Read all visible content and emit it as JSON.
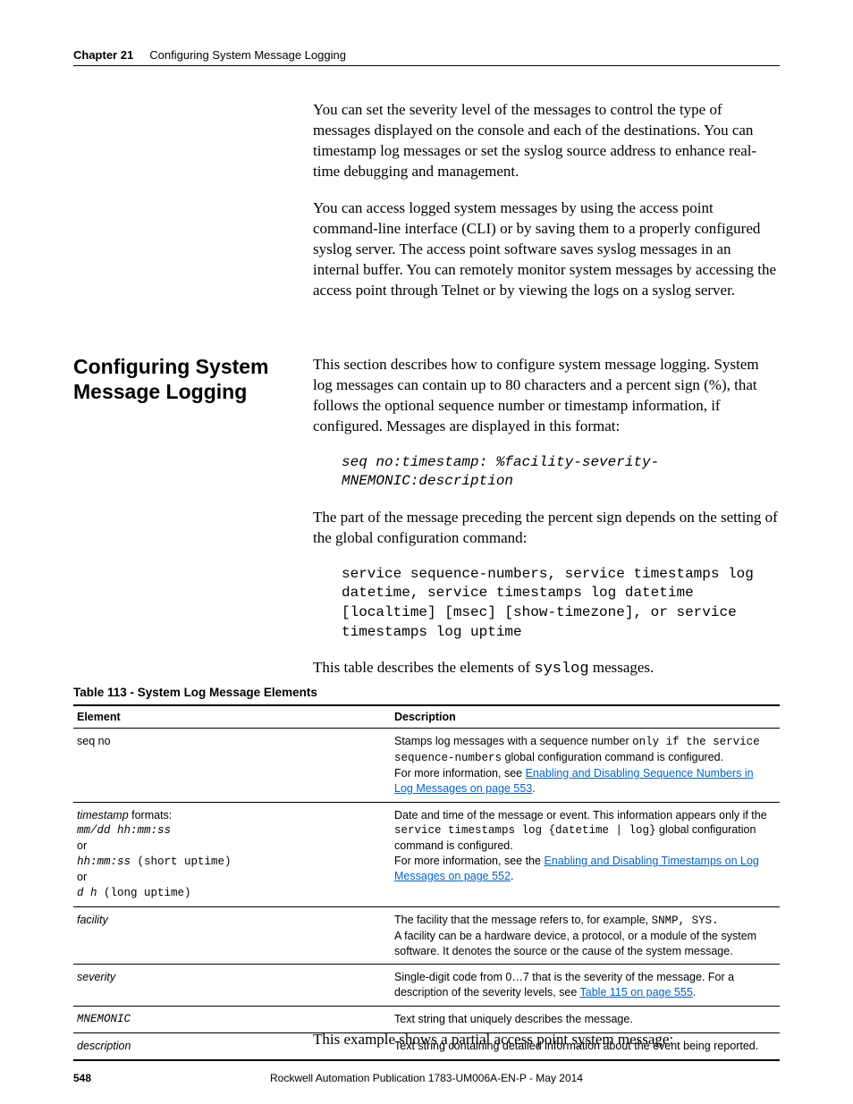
{
  "header": {
    "chapter": "Chapter 21",
    "title": "Configuring System Message Logging"
  },
  "intro": {
    "p1": "You can set the severity level of the messages to control the type of messages displayed on the console and each of the destinations. You can timestamp log messages or set the syslog source address to enhance real-time debugging and management.",
    "p2": "You can access logged system messages by using the access point command-line interface (CLI) or by saving them to a properly configured syslog server. The access point software saves syslog messages in an internal buffer. You can remotely monitor system messages by accessing the access point through Telnet or by viewing the logs on a syslog server."
  },
  "section": {
    "heading": "Configuring System Message Logging",
    "p1": "This section describes how to configure system message logging. System log messages can contain up to 80 characters and a percent sign (%), that follows the optional sequence number or timestamp information, if configured. Messages are displayed in this format:",
    "code1": "seq no:timestamp: %facility-severity-MNEMONIC:description",
    "p2": "The part of the message preceding the percent sign depends on the setting of the global configuration command:",
    "code2": "service sequence-numbers, service timestamps log datetime, service timestamps log datetime [localtime] [msec] [show-timezone], or service timestamps log uptime",
    "p3_pre": "This table describes the elements of ",
    "p3_mono": "syslog",
    "p3_post": " messages."
  },
  "table": {
    "caption": "Table 113 - System Log Message Elements",
    "head_el": "Element",
    "head_desc": "Description",
    "rows": {
      "r0": {
        "el": "seq no",
        "d_pre": "Stamps log messages with a sequence number ",
        "d_mono": "only if the service sequence-numbers",
        "d_mid": " global configuration command is configured.",
        "d_more": "For more information, see ",
        "d_link": "Enabling and Disabling Sequence Numbers in Log Messages on page 553",
        "d_after": "."
      },
      "r1": {
        "el_label": "timestamp",
        "el_formats": " formats:",
        "el_l1": "mm/dd hh:mm:ss",
        "el_or1": "or",
        "el_l2a": "hh:mm:ss",
        "el_l2b": " (short uptime)",
        "el_or2": "or",
        "el_l3a": "d h",
        "el_l3b": " (long uptime)",
        "d_pre": "Date and time of the message or event. This information appears only if the ",
        "d_mono": "service timestamps log {datetime | log}",
        "d_mid": " global configuration command is configured.",
        "d_more": "For more information, see the ",
        "d_link": "Enabling and Disabling Timestamps on Log Messages on page 552",
        "d_after": "."
      },
      "r2": {
        "el": "facility",
        "d_pre": "The facility that the message refers to, for example, ",
        "d_mono": "SNMP, SYS.",
        "d_line2": "A facility can be a hardware device, a protocol, or a module of the system software. It denotes the source or the cause of the system message."
      },
      "r3": {
        "el": "severity",
        "d_pre": "Single-digit code from 0…7 that is the severity of the message. For a description of the severity levels, see ",
        "d_link": "Table 115 on page 555",
        "d_after": "."
      },
      "r4": {
        "el": "MNEMONIC",
        "d": "Text string that uniquely describes the message."
      },
      "r5": {
        "el": "description",
        "d": "Text string containing detailed information about the event being reported."
      }
    }
  },
  "after_table": "This example shows a partial access point system message:",
  "footer": {
    "page": "548",
    "pub": "Rockwell Automation Publication 1783-UM006A-EN-P - May 2014"
  }
}
